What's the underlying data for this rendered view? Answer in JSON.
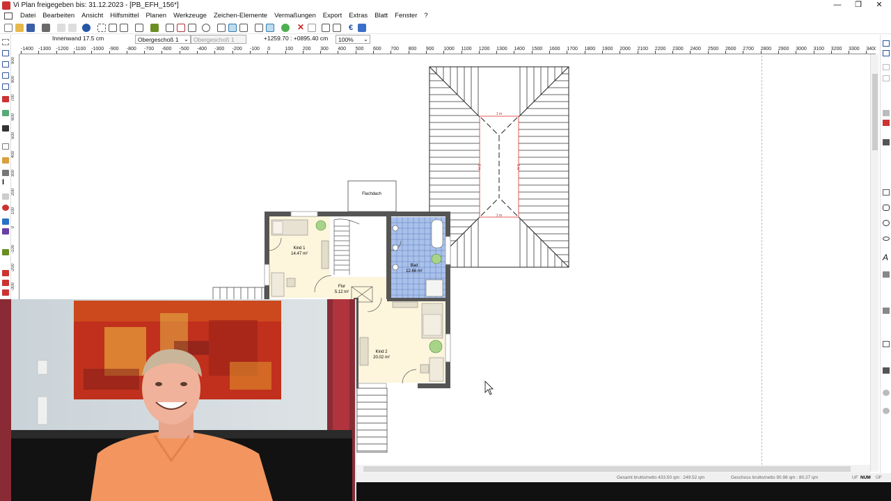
{
  "window": {
    "title": "Vi Plan freigegeben bis: 31.12.2023 - [PB_EFH_156*]"
  },
  "window_controls": {
    "minimize": "—",
    "maximize": "❐",
    "close": "✕"
  },
  "menu": [
    "Datei",
    "Bearbeiten",
    "Ansicht",
    "Hilfsmittel",
    "Planen",
    "Werkzeuge",
    "Zeichen-Elemente",
    "Vermaßungen",
    "Export",
    "Extras",
    "Blatt",
    "Fenster",
    "?"
  ],
  "options": {
    "wall_type": "Innenwand 17.5 cm",
    "floor_select": "Obergeschoß 1",
    "floor_select_2": "Obergeschoß 1",
    "coordinates": "+1259.70 : +0895.40 cm",
    "zoom": "100%"
  },
  "ruler": {
    "h_ticks": [
      "-1400",
      "-1300",
      "-1200",
      "-1100",
      "-1000",
      "-900",
      "-800",
      "-700",
      "-600",
      "-500",
      "-400",
      "-300",
      "-200",
      "-100",
      "0",
      "100",
      "200",
      "300",
      "400",
      "500",
      "600",
      "700",
      "800",
      "900",
      "1000",
      "1100",
      "1200",
      "1300",
      "1400",
      "1500",
      "1600",
      "1700",
      "1800",
      "1900",
      "2000",
      "2100",
      "2200",
      "2300",
      "2400",
      "2500",
      "2600",
      "2700",
      "2800",
      "2900",
      "3000",
      "3100",
      "3200",
      "3300",
      "3400"
    ],
    "v_ticks": [
      "900",
      "800",
      "700",
      "600",
      "500",
      "400",
      "300",
      "200",
      "100",
      "0",
      "-100",
      "-200",
      "-300"
    ]
  },
  "plan": {
    "flat_roof_label": "Flachdach",
    "roof_dim_labels": [
      "1 m",
      "1 m",
      "1 m",
      "1 m"
    ],
    "rooms": [
      {
        "name": "Kind 1",
        "area": "14.47 m²"
      },
      {
        "name": "Flur",
        "area": "5.12 m²"
      },
      {
        "name": "Bad",
        "area": "12.66 m²"
      },
      {
        "name": "Kind 2",
        "area": "20.02 m²"
      }
    ]
  },
  "status": {
    "gesamt": "Gesamt brutto/netto 433.50 qm : 249.52 qm",
    "geschoss": "Geschoss brutto/netto 90.98 qm : 80.27 qm",
    "uf": "UF",
    "num": "NUM",
    "ff": "ÜF"
  },
  "colors": {
    "wall": "#555555",
    "floor_warm": "#fdf5dc",
    "bath_tile": "#a9c1ea",
    "roof_dim": "#cc2222",
    "shirt": "#f2955f",
    "painting_red": "#c0301c"
  }
}
